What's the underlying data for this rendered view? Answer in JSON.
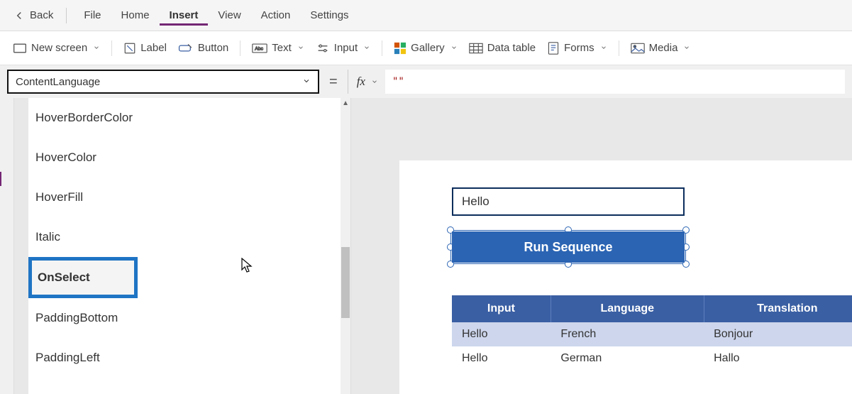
{
  "menubar": {
    "back": "Back",
    "items": [
      "File",
      "Home",
      "Insert",
      "View",
      "Action",
      "Settings"
    ],
    "active_index": 2
  },
  "toolbar": {
    "new_screen": "New screen",
    "label": "Label",
    "button": "Button",
    "text": "Text",
    "input": "Input",
    "gallery": "Gallery",
    "data_table": "Data table",
    "forms": "Forms",
    "media": "Media"
  },
  "formula": {
    "property_selected": "ContentLanguage",
    "fx": "fx",
    "value": "\"\""
  },
  "property_dropdown": {
    "items": [
      "HoverBorderColor",
      "HoverColor",
      "HoverFill",
      "Italic",
      "OnSelect",
      "PaddingBottom",
      "PaddingLeft"
    ],
    "highlighted_index": 4
  },
  "canvas": {
    "textinput_value": "Hello",
    "button_label": "Run Sequence",
    "table": {
      "headers": [
        "Input",
        "Language",
        "Translation"
      ],
      "rows": [
        [
          "Hello",
          "French",
          "Bonjour"
        ],
        [
          "Hello",
          "German",
          "Hallo"
        ]
      ]
    }
  }
}
